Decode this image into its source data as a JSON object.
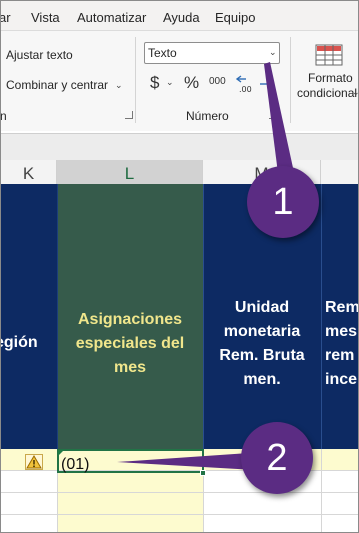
{
  "menu": {
    "items": [
      "ar",
      "Vista",
      "Automatizar",
      "Ayuda",
      "Equipo"
    ]
  },
  "ribbon": {
    "ajustar_texto": "Ajustar texto",
    "combinar_centrar": "Combinar y centrar",
    "alignment_group_tail": "n",
    "number_format_value": "Texto",
    "currency_symbol": "$",
    "percent_symbol": "%",
    "comma_symbol": "000",
    "group_numero": "Número",
    "formato_condicional_line1": "Formato",
    "formato_condicional_line2": "condicional"
  },
  "sheet": {
    "columns": {
      "k": "K",
      "l": "L",
      "m": "M"
    },
    "headers": {
      "k": "egión",
      "l": "Asignaciones especiales del mes",
      "m": "Unidad monetaria Rem. Bruta men.",
      "n": "Rem mes rem ince"
    },
    "active_cell_value": "(01)"
  },
  "callouts": {
    "one": "1",
    "two": "2"
  },
  "colors": {
    "header_blue": "#0d2a63",
    "header_green": "#365b4b",
    "header_green_text": "#f0e68c",
    "data_row_yellow": "#fdfbcf",
    "callout_purple": "#5b2c83",
    "excel_green": "#217346"
  }
}
